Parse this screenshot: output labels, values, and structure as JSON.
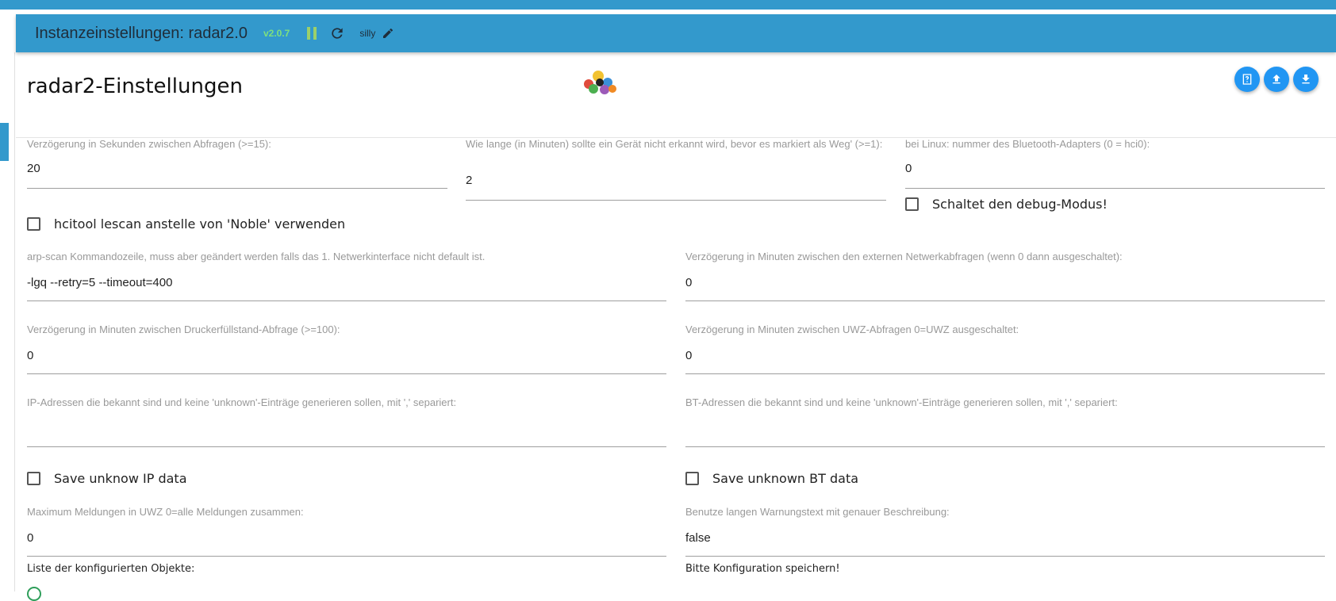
{
  "header": {
    "title": "Instanzeinstellungen: radar2.0",
    "version": "v2.0.7",
    "log_level": "silly"
  },
  "page": {
    "title": "radar2-Einstellungen"
  },
  "fields": {
    "delay_seconds": {
      "label": "Verzögerung in Sekunden zwischen Abfragen (>=15):",
      "value": "20"
    },
    "away_minutes": {
      "label": "Wie lange (in Minuten) sollte ein Gerät nicht erkannt wird, bevor es markiert als Weg' (>=1):",
      "value": "2"
    },
    "bt_adapter": {
      "label": "bei Linux: nummer des Bluetooth-Adapters (0 = hci0):",
      "value": "0"
    },
    "arp_scan": {
      "label": "arp-scan Kommandozeile, muss aber geändert werden falls das 1. Netwerkinterface nicht default ist.",
      "value": "-lgq --retry=5 --timeout=400"
    },
    "ext_network_delay": {
      "label": "Verzögerung in Minuten zwischen den externen Netwerkabfragen (wenn 0 dann ausgeschaltet):",
      "value": "0"
    },
    "printer_delay": {
      "label": "Verzögerung in Minuten zwischen Druckerfüllstand-Abfrage (>=100):",
      "value": "0"
    },
    "uwz_delay": {
      "label": "Verzögerung in Minuten zwischen UWZ-Abfragen 0=UWZ ausgeschaltet:",
      "value": "0"
    },
    "known_ips": {
      "label": "IP-Adressen die bekannt sind und keine 'unknown'-Einträge generieren sollen, mit ',' separiert:",
      "value": ""
    },
    "known_bts": {
      "label": "BT-Adressen die bekannt sind und keine 'unknown'-Einträge generieren sollen, mit ',' separiert:",
      "value": ""
    },
    "uwz_max": {
      "label": "Maximum Meldungen in UWZ 0=alle Meldungen zusammen:",
      "value": "0"
    },
    "long_warning": {
      "label": "Benutze langen Warnungstext mit genauer Beschreibung:",
      "value": "false"
    }
  },
  "checkboxes": {
    "debug": {
      "label": "Schaltet den debug-Modus!"
    },
    "hcitool": {
      "label": "hcitool lescan anstelle von 'Noble' verwenden"
    },
    "save_ip": {
      "label": "Save unknow IP data"
    },
    "save_bt": {
      "label": "Save unknown BT data"
    }
  },
  "texts": {
    "objects_list": "Liste der konfigurierten Objekte:",
    "save_hint": "Bitte Konfiguration speichern!"
  },
  "colors": {
    "header_bg": "#3399cc",
    "version": "#7ee07e",
    "fab": "#2196f3"
  },
  "icons": [
    "pause-icon",
    "refresh-icon",
    "edit-icon",
    "help-icon",
    "upload-icon",
    "download-icon"
  ]
}
